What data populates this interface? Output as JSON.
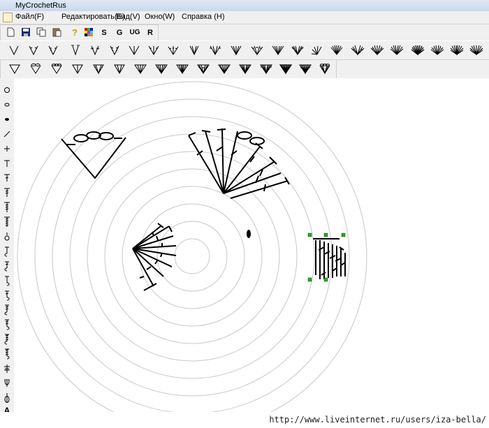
{
  "app": {
    "title": "MyCrochetRus"
  },
  "menu": [
    "Файл(F)",
    "Редактировать(E)",
    "Вид(V)",
    "Окно(W)",
    "Справка (H)"
  ],
  "toolbar1": {
    "letters": [
      "S",
      "G",
      "UG",
      "R"
    ]
  },
  "left_tools": {
    "text_tool": "A"
  },
  "footer": {
    "url": "http://www.liveinternet.ru/users/iza-bella/"
  },
  "colors": {
    "window_bg": "#f0f0f0",
    "canvas_bg": "#ffffff",
    "circle_stroke": "#c8c8c8",
    "selection_handle": "#22aa22"
  }
}
